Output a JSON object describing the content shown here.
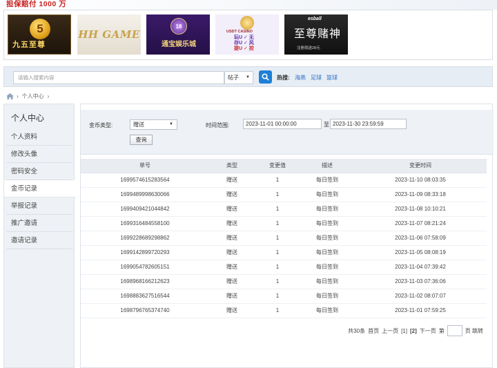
{
  "promo": {
    "text": "担保赔付 1000 万"
  },
  "banners": [
    {
      "logo_text": "九五至尊",
      "mark": "5"
    },
    {
      "logo_text": "HH GAME"
    },
    {
      "logo_text": "通宝娱乐城",
      "badge": "18"
    },
    {
      "title": "USDT CASINO",
      "rows": [
        "玩U ✓ 无",
        "存U ✓ 风",
        "提U ✓ 控"
      ]
    },
    {
      "brand": "esball",
      "big": "至尊赌神",
      "small": "注册就送28元"
    }
  ],
  "search": {
    "placeholder": "请输入搜索内容",
    "type_value": "帖子",
    "hot_label": "热搜:",
    "hot_links": [
      "海燕",
      "足球",
      "篮球"
    ]
  },
  "breadcrumb": {
    "current": "个人中心"
  },
  "sidebar": {
    "title": "个人中心",
    "items": [
      {
        "label": "个人资料"
      },
      {
        "label": "修改头像"
      },
      {
        "label": "密码安全"
      },
      {
        "label": "金币记录",
        "active": true
      },
      {
        "label": "举报记录"
      },
      {
        "label": "推广邀请"
      },
      {
        "label": "邀请记录"
      }
    ]
  },
  "filter": {
    "coin_type_label": "金币类型:",
    "coin_type_value": "赠送",
    "time_range_label": "时间范围:",
    "start": "2023-11-01 00:00:00",
    "to_label": "至",
    "end": "2023-11-30 23:59:59",
    "query_label": "查询"
  },
  "table": {
    "headers": [
      "单号",
      "类型",
      "变更值",
      "描述",
      "变更时间"
    ],
    "rows": [
      [
        "1699574615283564",
        "赠送",
        "1",
        "每日签到",
        "2023-11-10 08:03:35"
      ],
      [
        "1699489998630066",
        "赠送",
        "1",
        "每日签到",
        "2023-11-09 08:33:18"
      ],
      [
        "1699409421044842",
        "赠送",
        "1",
        "每日签到",
        "2023-11-08 10:10:21"
      ],
      [
        "1699316484558100",
        "赠送",
        "1",
        "每日签到",
        "2023-11-07 08:21:24"
      ],
      [
        "1699228689298862",
        "赠送",
        "1",
        "每日签到",
        "2023-11-06 07:58:09"
      ],
      [
        "1699142899720293",
        "赠送",
        "1",
        "每日签到",
        "2023-11-05 08:08:19"
      ],
      [
        "1699054782605151",
        "赠送",
        "1",
        "每日签到",
        "2023-11-04 07:39:42"
      ],
      [
        "1698968166212623",
        "赠送",
        "1",
        "每日签到",
        "2023-11-03 07:36:06"
      ],
      [
        "1698883627516544",
        "赠送",
        "1",
        "每日签到",
        "2023-11-02 08:07:07"
      ],
      [
        "1698796765374740",
        "赠送",
        "1",
        "每日签到",
        "2023-11-01 07:59:25"
      ]
    ]
  },
  "pager": {
    "total": "共30条",
    "first": "首页",
    "prev": "上一页",
    "page1": "[1]",
    "page2": "[2]",
    "next": "下一页",
    "goto_prefix": "第",
    "goto_suffix": "页 跳转"
  }
}
